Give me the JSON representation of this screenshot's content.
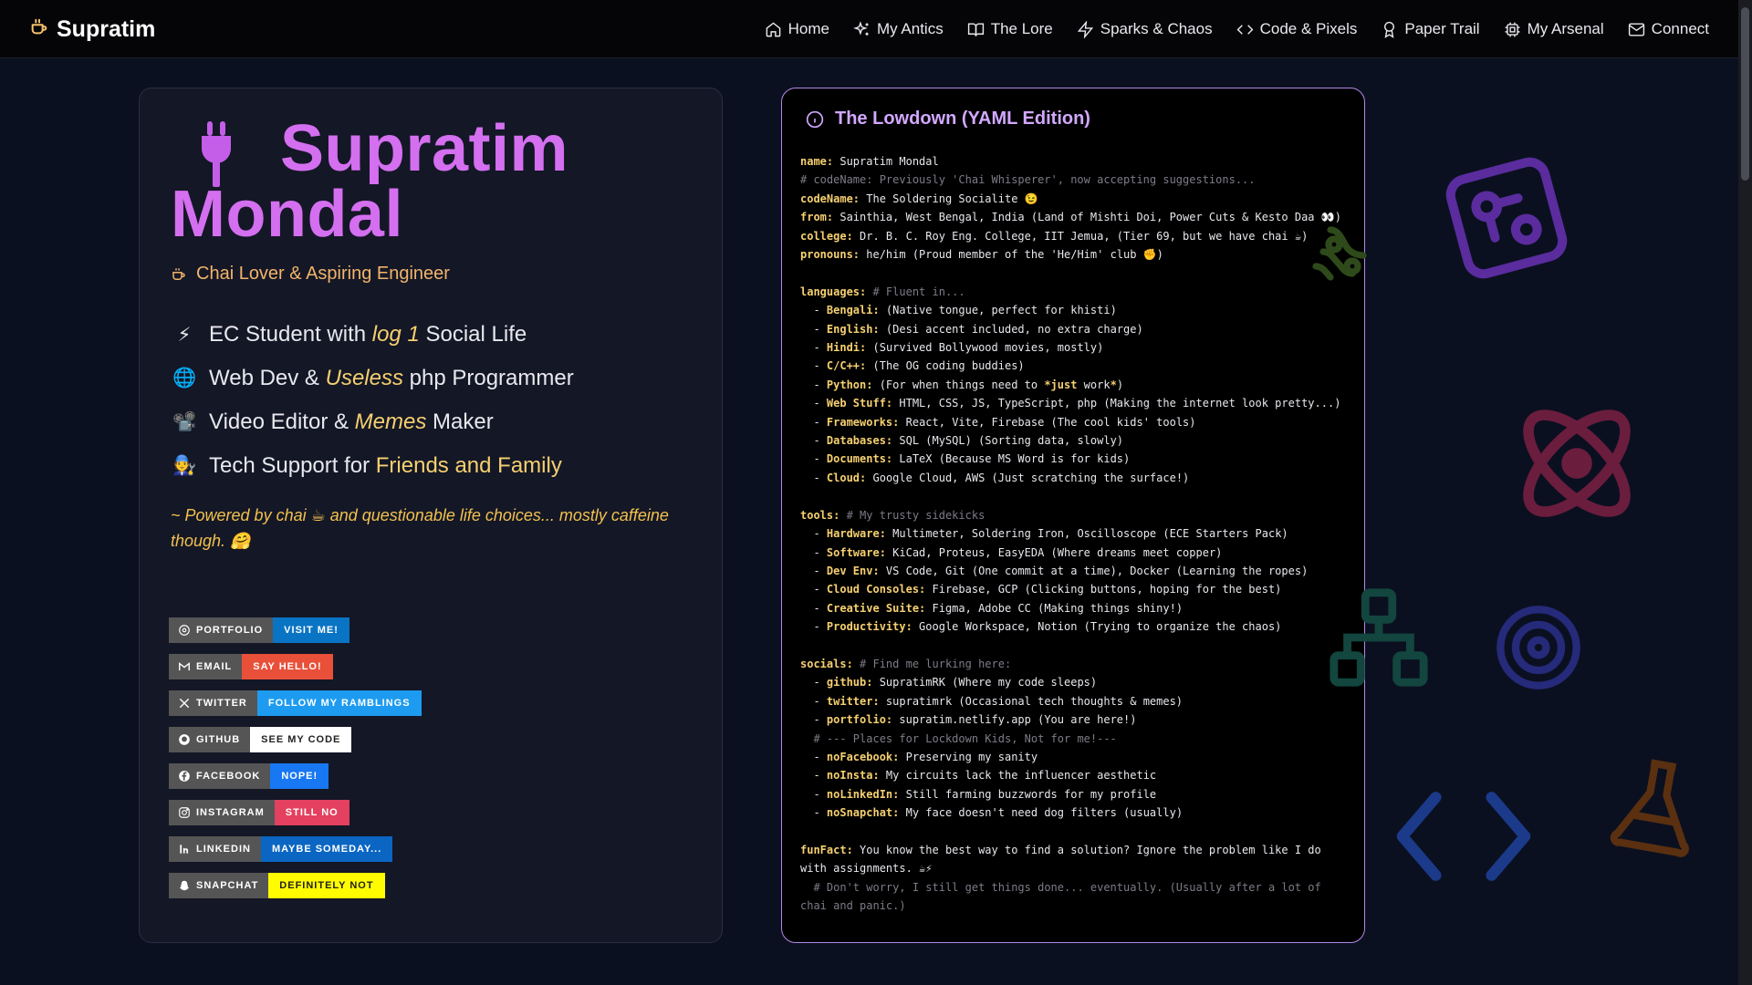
{
  "brand": {
    "name": "Supratim",
    "icon": "coffee-cup-icon"
  },
  "nav": [
    {
      "label": "Home",
      "icon": "home-icon"
    },
    {
      "label": "My Antics",
      "icon": "sparkles-icon"
    },
    {
      "label": "The Lore",
      "icon": "book-open-icon"
    },
    {
      "label": "Sparks & Chaos",
      "icon": "zap-icon"
    },
    {
      "label": "Code & Pixels",
      "icon": "code-icon"
    },
    {
      "label": "Paper Trail",
      "icon": "award-icon"
    },
    {
      "label": "My Arsenal",
      "icon": "cpu-icon"
    },
    {
      "label": "Connect",
      "icon": "mail-icon"
    }
  ],
  "hero": {
    "first_name": "Supratim",
    "last_name": "Mondal",
    "subtitle": "Chai Lover & Aspiring Engineer",
    "bullets": [
      {
        "icon": "⚡",
        "pre": "EC Student with ",
        "hl": "log 1",
        "post": " Social Life"
      },
      {
        "icon": "🌐",
        "pre": "Web Dev & ",
        "hl": "Useless",
        "post": " php Programmer"
      },
      {
        "icon": "📽️",
        "pre": "Video Editor & ",
        "hl": "Memes",
        "post": " Maker"
      },
      {
        "icon": "🧑‍🔧",
        "pre": "Tech Support for ",
        "hl": "Friends and Family",
        "post": ""
      }
    ],
    "powered": "~ Powered by chai ☕ and questionable life choices... mostly caffeine though. 🤗"
  },
  "badges": [
    {
      "label": "PORTFOLIO",
      "value": "VISIT ME!",
      "color": "#0a74c4",
      "text": "#ffffff",
      "icon": "chrome-icon"
    },
    {
      "label": "EMAIL",
      "value": "SAY HELLO!",
      "color": "#e8503a",
      "text": "#ffffff",
      "icon": "gmail-icon"
    },
    {
      "label": "TWITTER",
      "value": "FOLLOW MY RAMBLINGS",
      "color": "#1d9bf0",
      "text": "#ffffff",
      "icon": "x-icon"
    },
    {
      "label": "GITHUB",
      "value": "SEE MY CODE",
      "color": "#ffffff",
      "text": "#222222",
      "icon": "github-icon"
    },
    {
      "label": "FACEBOOK",
      "value": "NOPE!",
      "color": "#1877f2",
      "text": "#ffffff",
      "icon": "facebook-icon"
    },
    {
      "label": "INSTAGRAM",
      "value": "STILL NO",
      "color": "#e4405f",
      "text": "#ffffff",
      "icon": "instagram-icon"
    },
    {
      "label": "LINKEDIN",
      "value": "MAYBE SOMEDAY...",
      "color": "#0a66c2",
      "text": "#ffffff",
      "icon": "linkedin-icon"
    },
    {
      "label": "SNAPCHAT",
      "value": "DEFINITELY NOT",
      "color": "#fffc00",
      "text": "#222222",
      "icon": "snapchat-icon"
    }
  ],
  "yaml": {
    "title": "The Lowdown (YAML Edition)",
    "lines": [
      {
        "k": "name:",
        "v": " Supratim Mondal"
      },
      {
        "c": "# codeName: Previously 'Chai Whisperer', now accepting suggestions..."
      },
      {
        "k": "codeName:",
        "v": " The Soldering Socialite 😉"
      },
      {
        "k": "from:",
        "v": " Sainthia, West Bengal, India (Land of Mishti Doi, Power Cuts & Kesto Daa 👀)"
      },
      {
        "k": "college:",
        "v": " Dr. B. C. Roy Eng. College, IIT Jemua, (Tier 69, but we have chai ☕)"
      },
      {
        "k": "pronouns:",
        "v": " he/him (Proud member of the 'He/Him' club ✊)"
      },
      {
        "blank": true
      },
      {
        "k": "languages:",
        "c": " # Fluent in..."
      },
      {
        "i": "  - ",
        "k": "Bengali:",
        "v": " (Native tongue, perfect for khisti)"
      },
      {
        "i": "  - ",
        "k": "English:",
        "v": " (Desi accent included, no extra charge)"
      },
      {
        "i": "  - ",
        "k": "Hindi:",
        "v": " (Survived Bollywood movies, mostly)"
      },
      {
        "i": "  - ",
        "k": "C/C++:",
        "v": " (The OG coding buddies)"
      },
      {
        "i": "  - ",
        "k": "Python:",
        "v": " (For when things need to ",
        "h": "*just",
        "v2": " work",
        "h2": "*",
        "v3": ")"
      },
      {
        "i": "  - ",
        "k": "Web Stuff:",
        "v": " HTML, CSS, JS, TypeScript, php (Making the internet look pretty...)"
      },
      {
        "i": "  - ",
        "k": "Frameworks:",
        "v": " React, Vite, Firebase (The cool kids' tools)"
      },
      {
        "i": "  - ",
        "k": "Databases:",
        "v": " SQL (MySQL) (Sorting data, slowly)"
      },
      {
        "i": "  - ",
        "k": "Documents:",
        "v": " LaTeX (Because MS Word is for kids)"
      },
      {
        "i": "  - ",
        "k": "Cloud:",
        "v": " Google Cloud, AWS (Just scratching the surface!)"
      },
      {
        "blank": true
      },
      {
        "k": "tools:",
        "c": " # My trusty sidekicks"
      },
      {
        "i": "  - ",
        "k": "Hardware:",
        "v": " Multimeter, Soldering Iron, Oscilloscope (ECE Starters Pack)"
      },
      {
        "i": "  - ",
        "k": "Software:",
        "v": " KiCad, Proteus, EasyEDA (Where dreams meet copper)"
      },
      {
        "i": "  - ",
        "k": "Dev Env:",
        "v": " VS Code, Git (One commit at a time), Docker (Learning the ropes)"
      },
      {
        "i": "  - ",
        "k": "Cloud Consoles:",
        "v": " Firebase, GCP (Clicking buttons, hoping for the best)"
      },
      {
        "i": "  - ",
        "k": "Creative Suite:",
        "v": " Figma, Adobe CC (Making things shiny!)"
      },
      {
        "i": "  - ",
        "k": "Productivity:",
        "v": " Google Workspace, Notion (Trying to organize the chaos)"
      },
      {
        "blank": true
      },
      {
        "k": "socials:",
        "c": " # Find me lurking here:"
      },
      {
        "i": "  - ",
        "k": "github:",
        "v": " SupratimRK (Where my code sleeps)"
      },
      {
        "i": "  - ",
        "k": "twitter:",
        "v": " supratimrk (Occasional tech thoughts & memes)"
      },
      {
        "i": "  - ",
        "k": "portfolio:",
        "v": " supratim.netlify.app (You are here!)"
      },
      {
        "c": "  # --- Places for Lockdown Kids, Not for me!---"
      },
      {
        "i": "  - ",
        "k": "noFacebook:",
        "v": " Preserving my sanity"
      },
      {
        "i": "  - ",
        "k": "noInsta:",
        "v": " My circuits lack the influencer aesthetic"
      },
      {
        "i": "  - ",
        "k": "noLinkedIn:",
        "v": " Still farming buzzwords for my profile"
      },
      {
        "i": "  - ",
        "k": "noSnapchat:",
        "v": " My face doesn't need dog filters (usually)"
      },
      {
        "blank": true
      },
      {
        "k": "funFact:",
        "v": " You know the best way to find a solution? Ignore the problem like I do with assignments. ☕⚡"
      },
      {
        "c": "  # Don't worry, I still get things done... eventually. (Usually after a lot of chai and panic.)"
      }
    ]
  },
  "colors": {
    "accent": "#d46ff0",
    "key": "#f6d070",
    "comment": "#7c7c88",
    "bg": "#0b1020"
  }
}
